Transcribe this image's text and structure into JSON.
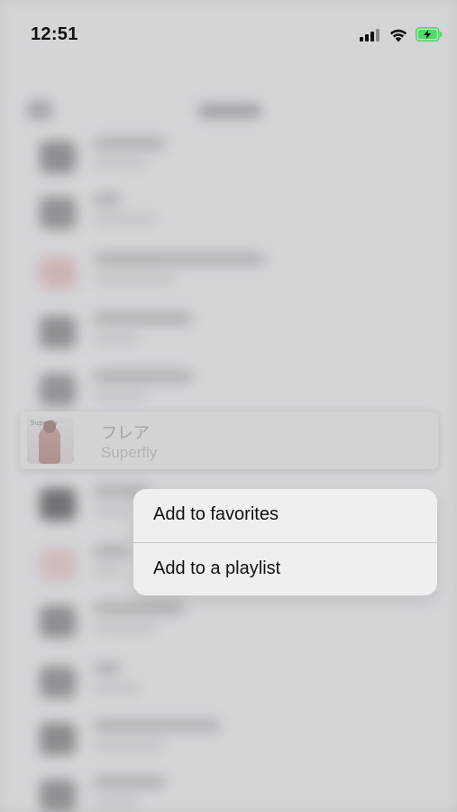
{
  "status_bar": {
    "time": "12:51",
    "icons": [
      "signal-icon",
      "wifi-icon",
      "battery-charging-icon"
    ],
    "battery_color": "#4cd964"
  },
  "preview": {
    "title": "フレア",
    "artist": "Superfly",
    "art_caption": "Superfly"
  },
  "context_menu": {
    "items": [
      {
        "label": "Add to favorites"
      },
      {
        "label": "Add to a playlist"
      }
    ]
  }
}
